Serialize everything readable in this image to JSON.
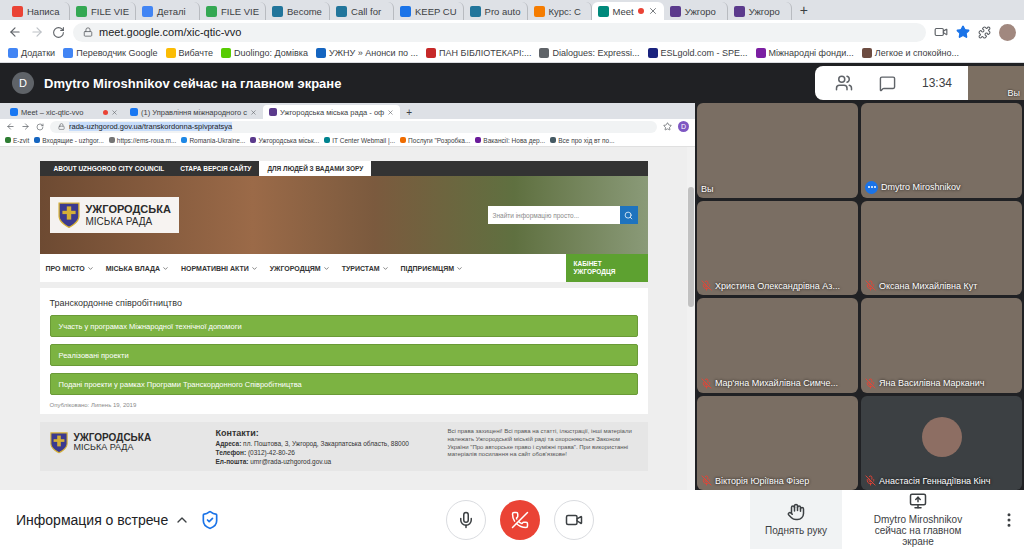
{
  "browser": {
    "tabs": [
      {
        "label": "Написа",
        "selected": false,
        "recording": false,
        "color": "#ea4335"
      },
      {
        "label": "FILE VIE",
        "selected": false,
        "recording": false,
        "color": "#34a853"
      },
      {
        "label": "Деталі",
        "selected": false,
        "recording": false,
        "color": "#4285f4"
      },
      {
        "label": "FILE VIE",
        "selected": false,
        "recording": false,
        "color": "#34a853"
      },
      {
        "label": "Become",
        "selected": false,
        "recording": false,
        "color": "#21759b"
      },
      {
        "label": "Call for",
        "selected": false,
        "recording": false,
        "color": "#21759b"
      },
      {
        "label": "KEEP CU",
        "selected": false,
        "recording": false,
        "color": "#1a73e8"
      },
      {
        "label": "Pro auto",
        "selected": false,
        "recording": false,
        "color": "#21759b"
      },
      {
        "label": "Курс: C",
        "selected": false,
        "recording": false,
        "color": "#f57c00"
      },
      {
        "label": "Meet",
        "selected": true,
        "recording": true,
        "color": "#00897b"
      },
      {
        "label": "Ужгоро",
        "selected": false,
        "recording": false,
        "color": "#5b3a8c"
      },
      {
        "label": "Ужгоро",
        "selected": false,
        "recording": false,
        "color": "#5b3a8c"
      }
    ],
    "new_tab": "+",
    "url": "meet.google.com/xic-qtic-vvo",
    "starred": true,
    "bookmarks": [
      {
        "label": "Додатки",
        "color": "#4285f4"
      },
      {
        "label": "Переводчик Google",
        "color": "#4285f4"
      },
      {
        "label": "Вибачте",
        "color": "#fbbc04"
      },
      {
        "label": "Duolingo: Домівка",
        "color": "#58cc02"
      },
      {
        "label": "УЖНУ » Анонси по ...",
        "color": "#1565c0"
      },
      {
        "label": "ПАН БІБЛІОТЕКАРІ:...",
        "color": "#c62828"
      },
      {
        "label": "Dialogues: Expressi...",
        "color": "#5f6368"
      },
      {
        "label": "ESLgold.com - SPE...",
        "color": "#1a237e"
      },
      {
        "label": "Міжнародні фонди...",
        "color": "#7b1fa2"
      },
      {
        "label": "Легкое и спокойно...",
        "color": "#6d4c41"
      }
    ]
  },
  "meet": {
    "presenter": {
      "avatar": "D",
      "text": "Dmytro Miroshnikov сейчас на главном экране"
    },
    "time": "13:34",
    "self_view": {
      "label": "Вы"
    },
    "shared_screen": {
      "tabs": [
        {
          "label": "Meet – xic-qtic-vvo",
          "selected": false,
          "recording": true
        },
        {
          "label": "(1) Управління міжнародного с",
          "selected": false,
          "recording": false
        },
        {
          "label": "Ужгородська міська рада - оф",
          "selected": true,
          "recording": false
        }
      ],
      "new_tab": "+",
      "url": "rada-uzhgorod.gov.ua/transkordonna-spivpratsya",
      "profile": "D",
      "bookmarks": [
        {
          "label": "E-zvit",
          "color": "#2e7d32"
        },
        {
          "label": "Входящие - uzhgor...",
          "color": "#1565c0"
        },
        {
          "label": "https://ems-roua.m...",
          "color": "#757575"
        },
        {
          "label": "Romania-Ukraine...",
          "color": "#1e88e5"
        },
        {
          "label": "Ужгородська міськ...",
          "color": "#5b3a8c"
        },
        {
          "label": "IT Center Webmail |...",
          "color": "#00838f"
        },
        {
          "label": "Послуги \"Розробка...",
          "color": "#ef6c00"
        },
        {
          "label": "Вакансії: Нова дер...",
          "color": "#6a1b9a"
        },
        {
          "label": "Все про хід вт по...",
          "color": "#455a64"
        }
      ],
      "site": {
        "top_links": [
          {
            "label": "ABOUT UZHGOROD CITY COUNCIL",
            "selected": false
          },
          {
            "label": "СТАРА ВЕРСІЯ САЙТУ",
            "selected": false
          },
          {
            "label": "ДЛЯ ЛЮДЕЙ З ВАДАМИ ЗОРУ",
            "selected": true
          }
        ],
        "logo": {
          "line1": "УЖГОРОДСЬКА",
          "line2": "МІСЬКА РАДА"
        },
        "search_placeholder": "Знайти інформацію просто...",
        "nav": [
          "ПРО МІСТО",
          "МІСЬКА ВЛАДА",
          "НОРМАТИВНІ АКТИ",
          "УЖГОРОДЦЯМ",
          "ТУРИСТАМ",
          "ПІДПРИЄМЦЯМ"
        ],
        "cabinet": "КАБІНЕТ УЖГОРОДЦЯ",
        "heading": "Транскордонне співробітництво",
        "links": [
          "Участь у програмах Міжнародної технічної допомоги",
          "Реалізовані проекти",
          "Подані проекти у рамках Програми Транскордонного Співробітництва"
        ],
        "published": "Опубліковано: Липень 19, 2019",
        "footer": {
          "logo": {
            "line1": "УЖГОРОДСЬКА",
            "line2": "МІСЬКА РАДА"
          },
          "contacts_title": "Контакти:",
          "contacts": [
            {
              "label": "Адреса:",
              "value": "пл. Поштова, 3, Ужгород, Закарпатська область, 88000"
            },
            {
              "label": "Телефон:",
              "value": "(0312)-42-80-26"
            },
            {
              "label": "Ел-пошта:",
              "value": "umr@rada-uzhgorod.gov.ua"
            }
          ],
          "rights": "Всі права захищені! Всі права на статті, ілюстрації, інші матеріали належать Ужгородській міській раді та охороняються Законом України \"Про авторське право і суміжні права\". При використанні матеріалів посилання на сайт обов'язкове!"
        }
      }
    },
    "participants": [
      {
        "name": "Вы",
        "kind": "video",
        "muted": false,
        "speaking": false
      },
      {
        "name": "Dmytro Miroshnikov",
        "kind": "video",
        "muted": false,
        "speaking": true
      },
      {
        "name": "Христина Олександрівна Аз...",
        "kind": "video",
        "muted": true,
        "speaking": false
      },
      {
        "name": "Оксана Михайлівна Кут",
        "kind": "video",
        "muted": true,
        "speaking": false
      },
      {
        "name": "Мар'яна Михайлівна Симче...",
        "kind": "video",
        "muted": true,
        "speaking": false
      },
      {
        "name": "Яна Василівна Марканич",
        "kind": "video",
        "muted": true,
        "speaking": false
      },
      {
        "name": "Вікторія Юріївна Фізер",
        "kind": "video",
        "muted": true,
        "speaking": false
      },
      {
        "name": "Анастасія Геннадіївна Кінч",
        "kind": "avatar",
        "muted": true,
        "speaking": false
      }
    ],
    "controls": {
      "meeting_info": "Информация о встрече",
      "mic_on": true,
      "camera_on": true,
      "raise_hand": "Поднять руку",
      "presenting": "Dmytro Miroshnikov сейчас на главном экране"
    }
  }
}
